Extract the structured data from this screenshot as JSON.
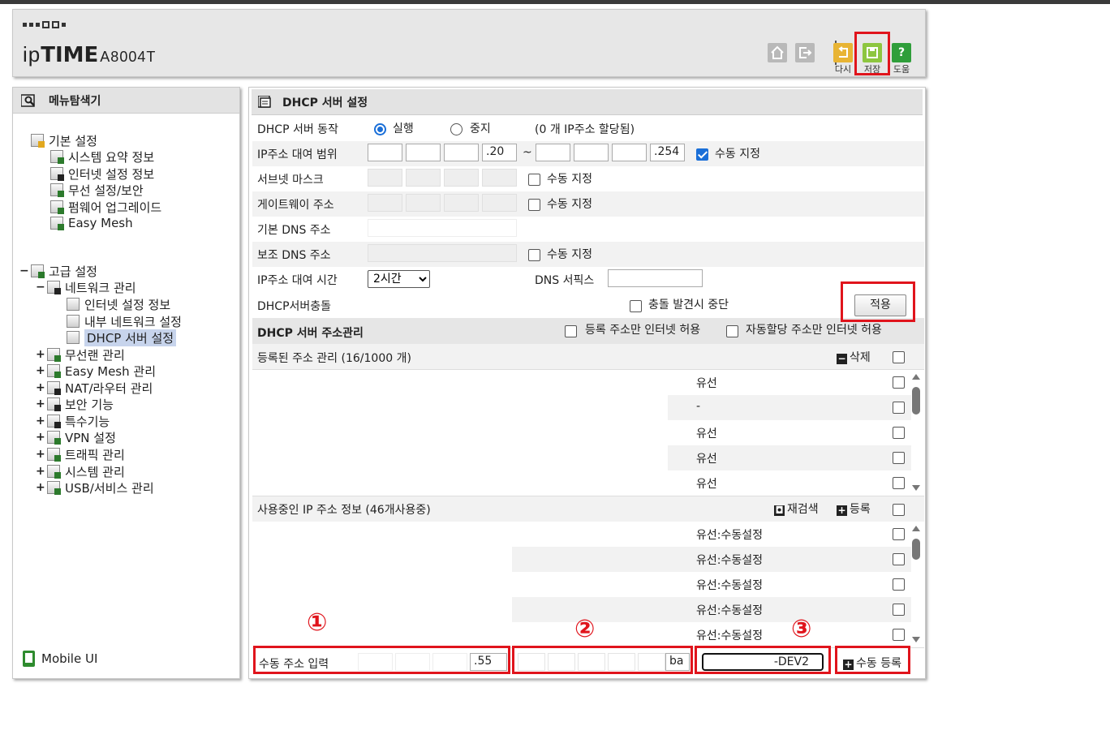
{
  "header": {
    "brand": "ipTIME",
    "brand_prefix": "ip",
    "brand_suffix": "TIME",
    "model": "A8004T",
    "buttons": {
      "home_icon": "home-icon",
      "logout_icon": "logout-icon",
      "redo_label": "다시",
      "save_label": "저장",
      "help_label": "도움"
    }
  },
  "sidebar": {
    "title": "메뉴탐색기",
    "basic": {
      "label": "기본 설정",
      "items": [
        "시스템 요약 정보",
        "인터넷 설정 정보",
        "무선 설정/보안",
        "펌웨어 업그레이드",
        "Easy Mesh"
      ]
    },
    "advanced": {
      "label": "고급 설정",
      "network": {
        "label": "네트워크 관리",
        "items": [
          "인터넷 설정 정보",
          "내부 네트워크 설정",
          "DHCP 서버 설정"
        ]
      },
      "items": [
        "무선랜 관리",
        "Easy Mesh 관리",
        "NAT/라우터 관리",
        "보안 기능",
        "특수기능",
        "VPN 설정",
        "트래픽 관리",
        "시스템 관리",
        "USB/서비스 관리"
      ]
    },
    "mobile_ui": "Mobile UI"
  },
  "main": {
    "title": "DHCP 서버 설정",
    "server_action": {
      "label": "DHCP 서버 동작",
      "run": "실행",
      "stop": "중지",
      "allocated": "(0 개 IP주소 할당됨)"
    },
    "ip_range": {
      "label": "IP주소 대여 범위",
      "start_last": ".20",
      "tilde": "~",
      "end_last": ".254",
      "manual": "수동 지정"
    },
    "subnet": {
      "label": "서브넷 마스크",
      "manual": "수동 지정"
    },
    "gateway": {
      "label": "게이트웨이 주소",
      "manual": "수동 지정"
    },
    "dns1": {
      "label": "기본 DNS 주소"
    },
    "dns2": {
      "label": "보조 DNS 주소",
      "manual": "수동 지정"
    },
    "lease": {
      "label": "IP주소 대여 시간",
      "value": "2시간",
      "dns_suffix": "DNS 서픽스"
    },
    "conflict": {
      "label": "DHCP서버충돌",
      "stop_on_conflict": "충돌 발견시 중단",
      "apply": "적용"
    },
    "address_mgmt": {
      "title": "DHCP 서버 주소관리",
      "registered_only": "등록 주소만 인터넷 허용",
      "auto_only": "자동할당 주소만 인터넷 허용"
    },
    "registered": {
      "title": "등록된 주소 관리 (16/1000 개)",
      "delete": "삭제",
      "rows": [
        "유선",
        "-",
        "유선",
        "유선",
        "유선"
      ]
    },
    "in_use": {
      "title": "사용중인 IP 주소 정보 (46개사용중)",
      "rescan": "재검색",
      "register": "등록",
      "rows": [
        "유선:수동설정",
        "유선:수동설정",
        "유선:수동설정",
        "유선:수동설정",
        "유선:수동설정"
      ]
    },
    "manual_input": {
      "label": "수동 주소 입력",
      "ip_last": ".55",
      "mac_tail": "ba",
      "name": "-DEV2",
      "register": "수동 등록"
    },
    "annotations": [
      "①",
      "②",
      "③"
    ]
  }
}
